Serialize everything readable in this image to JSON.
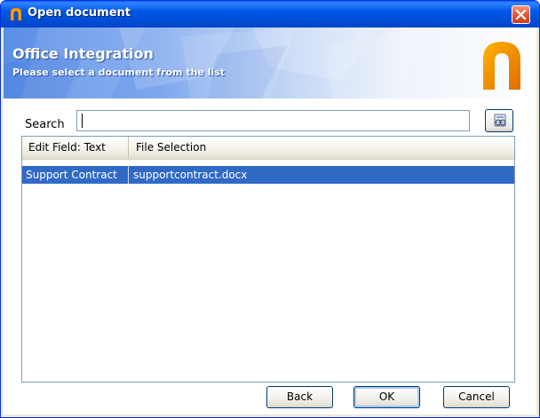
{
  "window": {
    "title": "Open document",
    "colors": {
      "titlebar": "#0055e5",
      "selection": "#316ac5",
      "close": "#e2552e",
      "logo": "#f28c00"
    }
  },
  "banner": {
    "heading": "Office Integration",
    "subtitle": "Please select a document from the list",
    "logo_icon": "arch-logo-icon"
  },
  "search": {
    "label": "Search",
    "value": "",
    "button_icon": "search-binoculars-icon"
  },
  "list": {
    "columns": [
      "Edit Field: Text",
      "File Selection"
    ],
    "rows": [
      {
        "text": "Support Contract",
        "file": "supportcontract.docx",
        "selected": true
      }
    ]
  },
  "buttons": {
    "back": "Back",
    "ok": "OK",
    "cancel": "Cancel"
  }
}
